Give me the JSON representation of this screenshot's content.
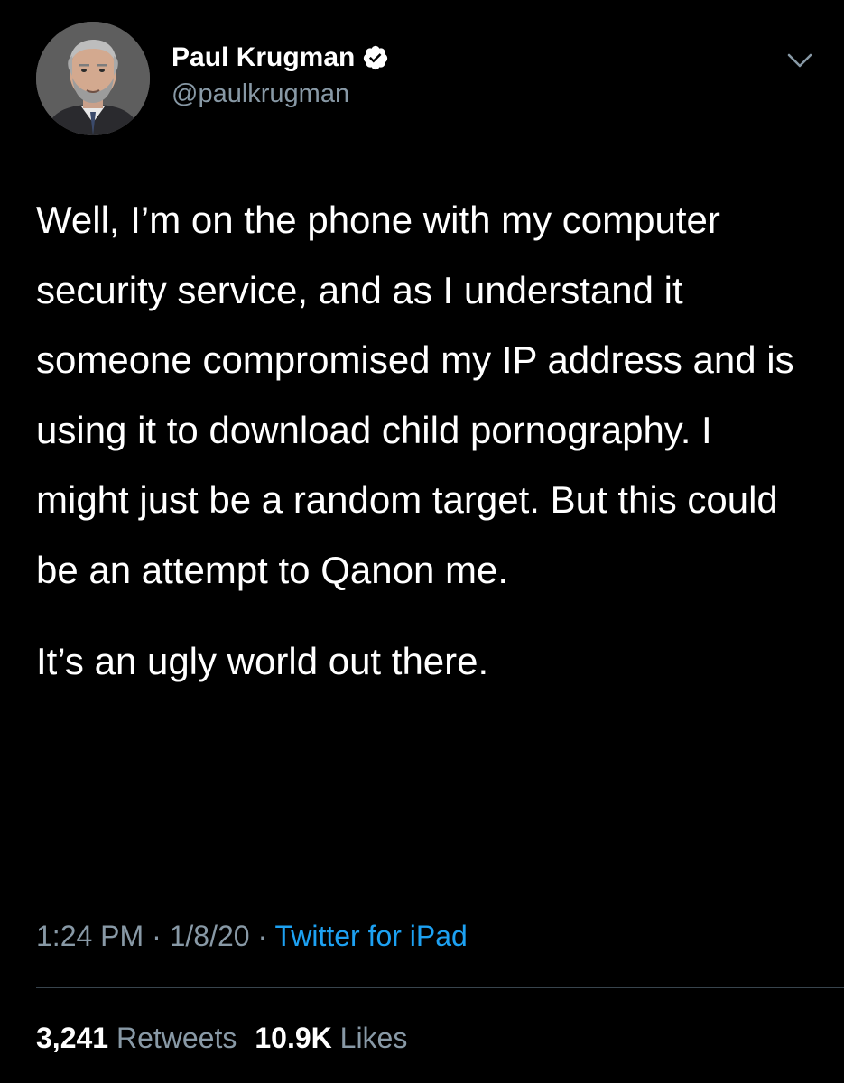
{
  "tweet": {
    "author": {
      "display_name": "Paul Krugman",
      "handle": "@paulkrugman",
      "verified": true
    },
    "text_paragraphs": [
      "Well, I’m on the phone with my computer security service, and as I understand it someone compromised my IP address and is using it to download child pornography. I might just be a random target. But this could be an attempt to Qanon me.",
      "It’s an ugly world out there."
    ],
    "meta": {
      "time": "1:24 PM",
      "separator": "·",
      "date": "1/8/20",
      "source": "Twitter for iPad"
    },
    "stats": {
      "retweets_count": "3,241",
      "retweets_label": "Retweets",
      "likes_count": "10.9K",
      "likes_label": "Likes"
    }
  },
  "colors": {
    "background": "#000000",
    "text_primary": "#ffffff",
    "text_secondary": "#8899a6",
    "link": "#1da1f2",
    "verified_badge": "#ffffff",
    "divider": "#38444d"
  },
  "icons": {
    "verified": "verified-badge-icon",
    "more": "chevron-down-icon"
  }
}
